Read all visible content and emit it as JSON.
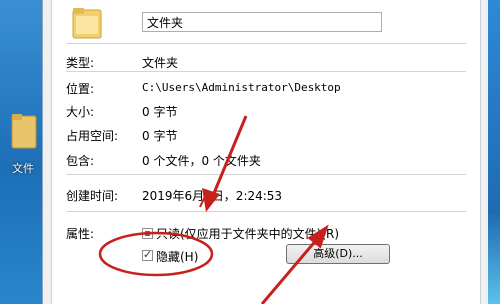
{
  "desktop": {
    "folder_label": "文件"
  },
  "dialog": {
    "name_value": "文件夹",
    "rows": {
      "type_label": "类型:",
      "type_value": "文件夹",
      "location_label": "位置:",
      "location_value": "C:\\Users\\Administrator\\Desktop",
      "size_label": "大小:",
      "size_value": "0 字节",
      "disk_label": "占用空间:",
      "disk_value": "0 字节",
      "contains_label": "包含:",
      "contains_value": "0 个文件，0 个文件夹",
      "created_label": "创建时间:",
      "created_value": "2019年6月1日，2:24:53"
    },
    "attributes_label": "属性:",
    "readonly_label": "只读(仅应用于文件夹中的文件)(R)",
    "hidden_label": "隐藏(H)",
    "advanced_label": "高级(D)..."
  },
  "annotation_color": "#c8201c"
}
